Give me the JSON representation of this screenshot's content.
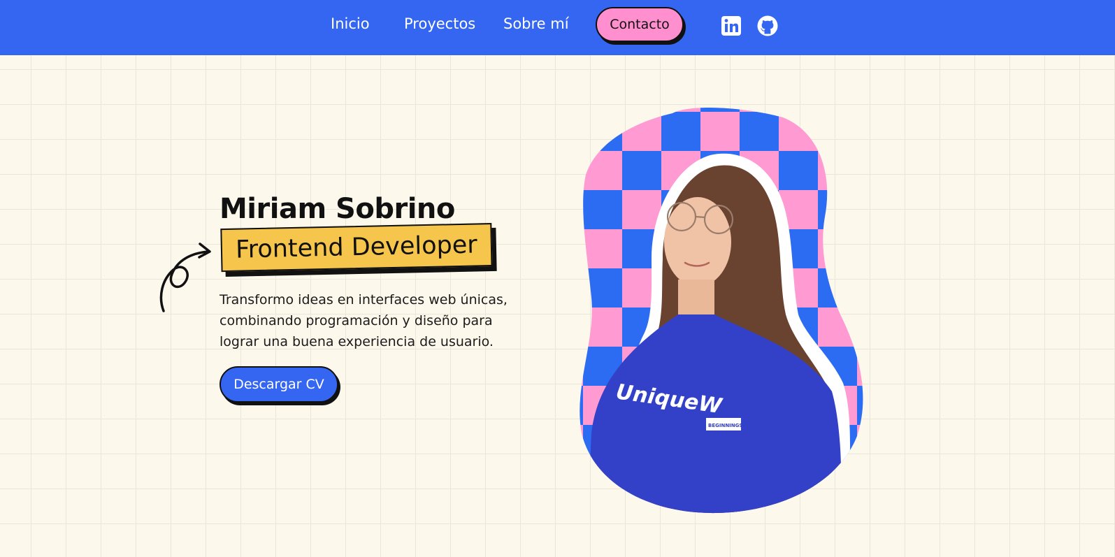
{
  "nav": {
    "items": [
      {
        "label": "Inicio"
      },
      {
        "label": "Proyectos"
      },
      {
        "label": "Sobre mí"
      }
    ],
    "contact_label": "Contacto",
    "socials": [
      {
        "icon": "linkedin-icon"
      },
      {
        "icon": "github-icon"
      }
    ]
  },
  "hero": {
    "name": "Miriam Sobrino",
    "role": "Frontend Developer",
    "description": "Transformo ideas en interfaces web únicas, combinando programación y diseño para lograr una buena experiencia de usuario.",
    "cta_label": "Descargar CV",
    "portrait_sweatshirt_text": "UniqueW",
    "portrait_badge_text": "BEGINNINGS"
  },
  "colors": {
    "primary": "#3566f2",
    "accent_pink": "#ff8fce",
    "accent_yellow": "#f5c54c",
    "background": "#fdf8ec",
    "text": "#111111"
  }
}
